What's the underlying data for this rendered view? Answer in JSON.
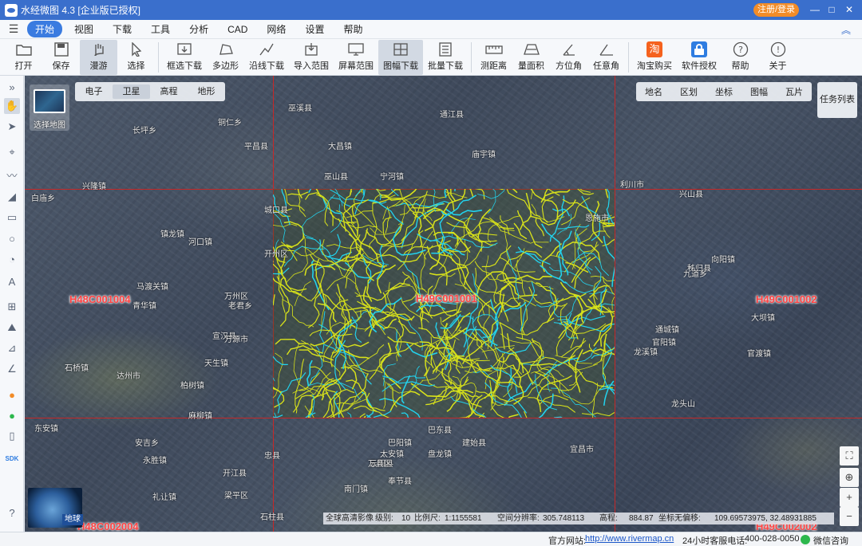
{
  "window": {
    "title": "水经微图 4.3 [企业版已授权]",
    "register_label": "注册/登录",
    "minimize": "—",
    "maximize": "□",
    "close": "✕"
  },
  "menu": {
    "items": [
      "开始",
      "视图",
      "下载",
      "工具",
      "分析",
      "CAD",
      "网络",
      "设置",
      "帮助"
    ],
    "active_index": 0
  },
  "toolbar": {
    "items": [
      {
        "label": "打开",
        "icon": "folder-icon"
      },
      {
        "label": "保存",
        "icon": "save-icon"
      },
      {
        "label": "漫游",
        "icon": "hand-icon",
        "active": true
      },
      {
        "label": "选择",
        "icon": "pointer-icon"
      },
      {
        "label": "框选下载",
        "icon": "box-download-icon"
      },
      {
        "label": "多边形",
        "icon": "polygon-icon"
      },
      {
        "label": "沿线下载",
        "icon": "line-download-icon"
      },
      {
        "label": "导入范围",
        "icon": "import-range-icon"
      },
      {
        "label": "屏幕范围",
        "icon": "screen-range-icon"
      },
      {
        "label": "图幅下载",
        "icon": "sheet-download-icon",
        "active": true
      },
      {
        "label": "批量下载",
        "icon": "batch-download-icon"
      },
      {
        "label": "测距离",
        "icon": "ruler-icon"
      },
      {
        "label": "量面积",
        "icon": "area-icon"
      },
      {
        "label": "方位角",
        "icon": "azimuth-icon"
      },
      {
        "label": "任意角",
        "icon": "angle-icon"
      },
      {
        "label": "淘宝购买",
        "icon": "taobao-icon"
      },
      {
        "label": "软件授权",
        "icon": "license-icon"
      },
      {
        "label": "帮助",
        "icon": "help-icon"
      },
      {
        "label": "关于",
        "icon": "info-icon"
      }
    ]
  },
  "map": {
    "thumb_label": "选择地图",
    "layer_tabs": [
      "电子",
      "卫星",
      "高程",
      "地形"
    ],
    "active_layer": "卫星",
    "right_tabs": [
      "地名",
      "区划",
      "坐标",
      "图幅",
      "瓦片"
    ],
    "task_button": "任务列表",
    "globe_label": "地球",
    "sheet_labels": {
      "left": "H48C001004",
      "center": "H49C001001",
      "right": "H49C001002",
      "bottom_left": "H48C002004",
      "bottom_right": "H49C002002"
    },
    "place_labels": [
      "巫溪县",
      "长坪乡",
      "铜仁乡",
      "巫山县",
      "兴隆镇",
      "白庙乡",
      "城口县",
      "开州区",
      "万州区",
      "宣汉县",
      "镇龙镇",
      "河口镇",
      "马渡关镇",
      "青华镇",
      "老君乡",
      "天生镇",
      "达州市",
      "石桥镇",
      "柏树镇",
      "麻柳镇",
      "万源市",
      "平昌县",
      "东安镇",
      "通江县",
      "安吉乡",
      "永胜镇",
      "礼让镇",
      "梁平区",
      "开江县",
      "忠县",
      "石柱县",
      "云阳县",
      "奉节县",
      "巴东县",
      "建始县",
      "恩施市",
      "利川市",
      "宜昌市",
      "兴山县",
      "秭归县",
      "宁河镇",
      "大昌镇",
      "庙宇镇",
      "龙溪镇",
      "官阳镇",
      "九道乡",
      "大坝镇",
      "通城镇",
      "官渡镇",
      "向阳镇",
      "龙头山",
      "南门镇",
      "巴阳镇",
      "太安镇",
      "盘龙镇",
      "万县区"
    ]
  },
  "infobar": {
    "source": "全球高清影像",
    "level_label": "级别:",
    "level_value": "10",
    "scale_label": "比例尺:",
    "scale_value": "1:1155581",
    "resolution_label": "空间分辨率:",
    "resolution_value": "305.748113",
    "elevation_label": "高程:",
    "elevation_value": "884.87",
    "coord_label": "坐标无偏移:",
    "coord_value": "109.69573975, 32.48931885"
  },
  "statusbar": {
    "site_label": "官方网站:",
    "site_url": "http://www.rivermap.cn",
    "hotline_label": "24小时客服电话:",
    "hotline_value": "400-028-0050",
    "wechat_label": "微信咨询"
  },
  "colors": {
    "titlebar": "#3a6fcc",
    "grid_line": "#c62828",
    "river_yellow": "#d8e21a",
    "river_cyan": "#22d3ee",
    "register_button": "#f28c28"
  }
}
